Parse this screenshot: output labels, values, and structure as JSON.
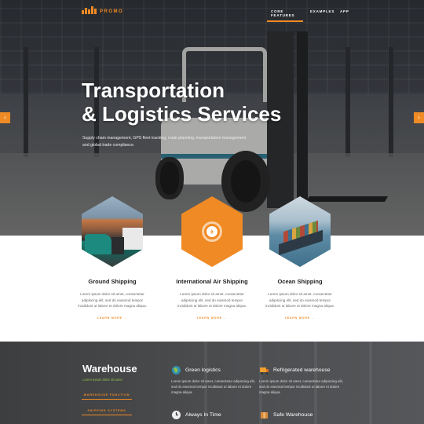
{
  "brand": {
    "logo_text": "PROMO",
    "accent_color": "#f08a24"
  },
  "nav": {
    "items": [
      {
        "label": "CORE FEATURES",
        "active": true
      },
      {
        "label": "EXAMPLES",
        "active": false
      },
      {
        "label": "APP",
        "active": false
      }
    ]
  },
  "hero": {
    "title_line1": "Transportation",
    "title_line2": "& Logistics Services",
    "subtitle": "Supply chain management, GPS fleet tracking, route planning, transportation management and global trade compliance.",
    "prev_icon": "chevron-left-icon",
    "next_icon": "chevron-right-icon"
  },
  "services": [
    {
      "title": "Ground Shipping",
      "text": "Lorem ipsum dolor sit amet, consectetur adipiscing elit, sed do eiusmod tempor incididunt ut labore et dolore magna aliqua.",
      "more": "LEARN MORE",
      "image": "truck-image"
    },
    {
      "title": "International Air Shipping",
      "text": "Lorem ipsum dolor sit amet, consectetur adipiscing elit, sed do eiusmod tempor incididunt ut labore et dolore magna aliqua.",
      "more": "LEARN MORE",
      "image": "airplane-icon"
    },
    {
      "title": "Ocean Shipping",
      "text": "Lorem ipsum dolor sit amet, consectetur adipiscing elit, sed do eiusmod tempor incididunt ut labore et dolore magna aliqua.",
      "more": "LEARN MORE",
      "image": "cargo-ship-image"
    }
  ],
  "warehouse": {
    "title": "Warehouse",
    "subtitle": "Lorem Ipsum dolor sit amet",
    "buttons": [
      "WAREHOUSE FUNCTION",
      "SHIPPING SYSTEMS"
    ],
    "features": [
      {
        "title": "Green logistics",
        "icon": "globe-icon",
        "text": "Lorem ipsum dolor sit amet, consectetur adipiscing elit, sed do eiusmod tempor incididunt ut labore et dolore magna aliqua."
      },
      {
        "title": "Refrigerated warehouse",
        "icon": "truck-icon",
        "text": "Lorem ipsum dolor sit amet, consectetur adipiscing elit, sed do eiusmod tempor incididunt ut labore et dolore magna aliqua."
      },
      {
        "title": "Always In Time",
        "icon": "clock-icon",
        "text": ""
      },
      {
        "title": "Safe Warehouse",
        "icon": "box-icon",
        "text": ""
      }
    ],
    "green_color": "#8fc24a"
  }
}
